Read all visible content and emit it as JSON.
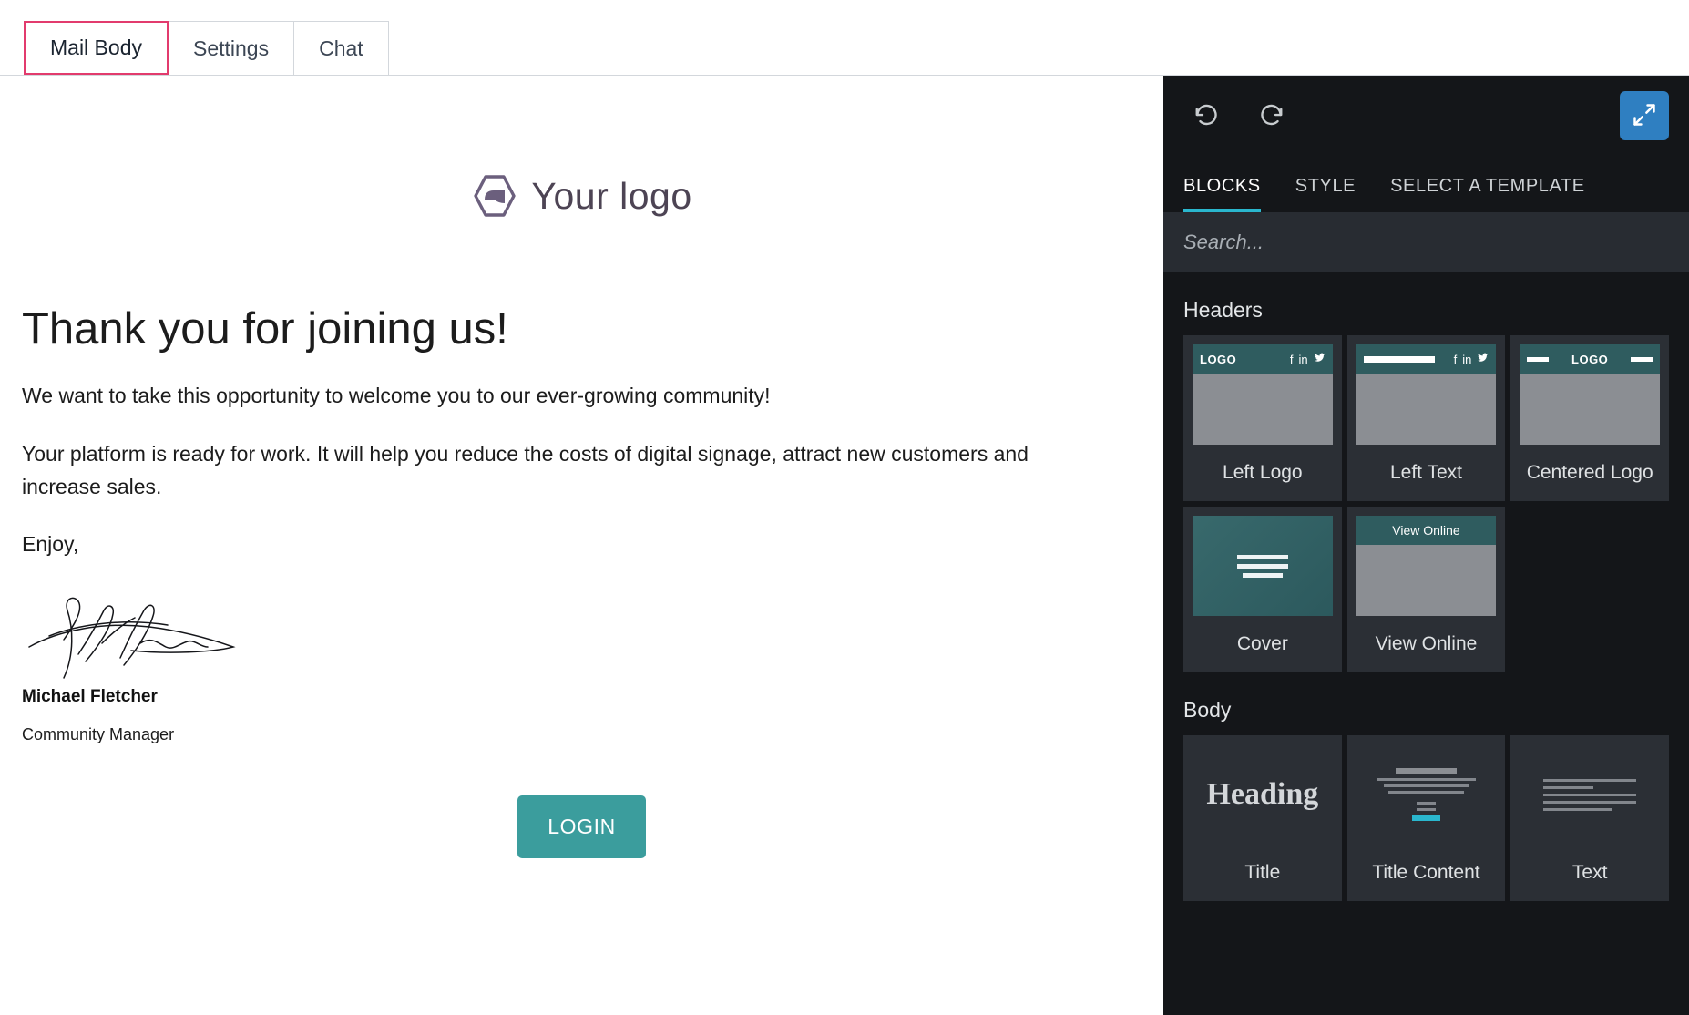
{
  "top_tabs": [
    {
      "label": "Mail Body",
      "active": true
    },
    {
      "label": "Settings",
      "active": false
    },
    {
      "label": "Chat",
      "active": false
    }
  ],
  "mail": {
    "logo_text": "Your logo",
    "heading": "Thank you for joining us!",
    "paragraph_1": "We want to take this opportunity to welcome you to our ever-growing community!",
    "paragraph_2": "Your platform is ready for work. It will help you reduce the costs of digital signage, attract new customers and increase sales.",
    "closing": "Enjoy,",
    "signature_name": "Michael Fletcher",
    "signature_role": "Community Manager",
    "button_label": "LOGIN"
  },
  "panel": {
    "toolbar": {
      "undo_label": "Undo",
      "redo_label": "Redo",
      "expand_label": "Expand"
    },
    "tabs": [
      {
        "label": "BLOCKS",
        "active": true
      },
      {
        "label": "STYLE",
        "active": false
      },
      {
        "label": "SELECT A TEMPLATE",
        "active": false
      }
    ],
    "search": {
      "value": "",
      "placeholder": "Search..."
    },
    "sections": [
      {
        "title": "Headers",
        "items": [
          {
            "label": "Left Logo",
            "thumb": "left-logo",
            "badge": "LOGO"
          },
          {
            "label": "Left Text",
            "thumb": "left-text"
          },
          {
            "label": "Centered Logo",
            "thumb": "centered-logo",
            "badge": "LOGO"
          },
          {
            "label": "Cover",
            "thumb": "cover"
          },
          {
            "label": "View Online",
            "thumb": "view-online",
            "badge": "View Online"
          }
        ]
      },
      {
        "title": "Body",
        "items": [
          {
            "label": "Title",
            "thumb": "title",
            "badge": "Heading"
          },
          {
            "label": "Title Content",
            "thumb": "title-content"
          },
          {
            "label": "Text",
            "thumb": "text"
          }
        ]
      }
    ]
  },
  "colors": {
    "accent_cyan": "#2ab7ce",
    "tab_active_border": "#e23b6d",
    "button_teal": "#3b9d9d",
    "expand_blue": "#2f7fc1",
    "panel_bg": "#141619",
    "card_bg": "#2b2f35",
    "thumb_teal": "#2f5c5f"
  }
}
